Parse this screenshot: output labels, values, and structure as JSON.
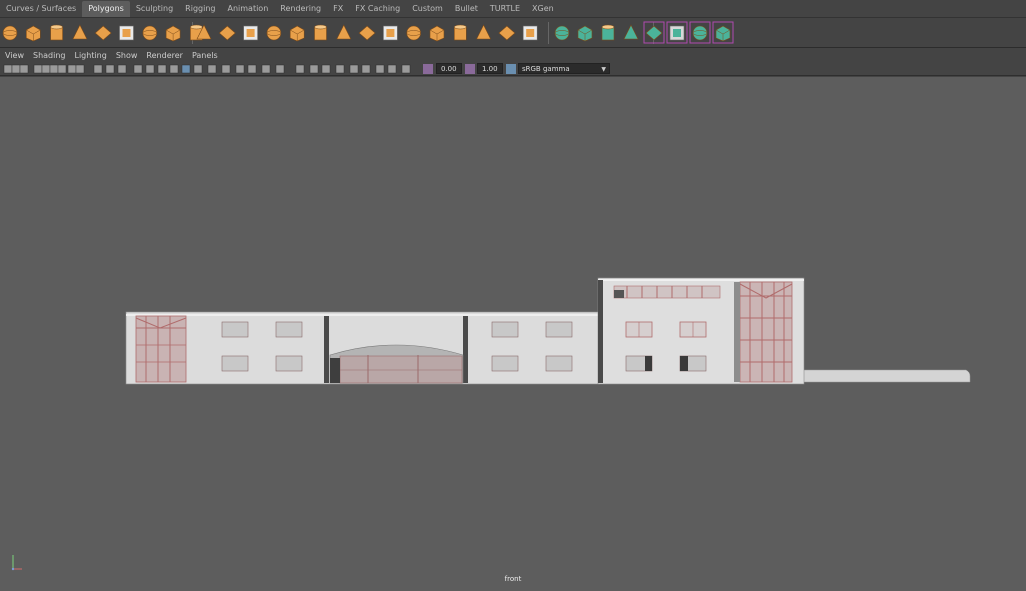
{
  "shelf": {
    "tabs": [
      {
        "label": "Curves / Surfaces",
        "active": false
      },
      {
        "label": "Polygons",
        "active": true
      },
      {
        "label": "Sculpting",
        "active": false
      },
      {
        "label": "Rigging",
        "active": false
      },
      {
        "label": "Animation",
        "active": false
      },
      {
        "label": "Rendering",
        "active": false
      },
      {
        "label": "FX",
        "active": false
      },
      {
        "label": "FX Caching",
        "active": false
      },
      {
        "label": "Custom",
        "active": false
      },
      {
        "label": "Bullet",
        "active": false
      },
      {
        "label": "TURTLE",
        "active": false
      },
      {
        "label": "XGen",
        "active": false
      }
    ],
    "icons": [
      "poly-sphere-icon",
      "poly-cube-icon",
      "poly-cylinder-icon",
      "poly-cone-icon",
      "poly-plane-icon",
      "poly-torus-icon",
      "poly-prism-icon",
      "poly-pyramid-icon",
      "poly-pipe-icon",
      "combine-icon",
      "separate-icon",
      "extract-icon",
      "smooth-icon",
      "boolean-icon",
      "reduce-icon",
      "cleanup-icon",
      "bevel-icon",
      "extrude-icon",
      "bridge-icon",
      "append-icon",
      "multi-cut-icon",
      "insert-edge-loop-icon",
      "offset-edge-loop-icon",
      "merge-icon",
      "uv-editor-icon",
      "planar-map-icon",
      "cylindrical-map-icon",
      "spherical-map-icon",
      "automatic-map-icon",
      "unfold-icon",
      "layout-uv-icon",
      "cut-uv-icon"
    ]
  },
  "panel": {
    "menu": [
      "View",
      "Shading",
      "Lighting",
      "Show",
      "Renderer",
      "Panels"
    ],
    "exposure": "0.00",
    "gamma": "1.00",
    "color_space": "sRGB gamma"
  },
  "viewport": {
    "camera_label": "front",
    "background": "#5d5d5d"
  },
  "colors": {
    "ui_bg": "#444444",
    "shelf_icon_orange": "#e8a04a",
    "shelf_icon_teal": "#4bb39a",
    "highlight_purple": "#b04ab0",
    "building_wall": "#d9d9d9",
    "window_frame": "#c27a7a"
  }
}
